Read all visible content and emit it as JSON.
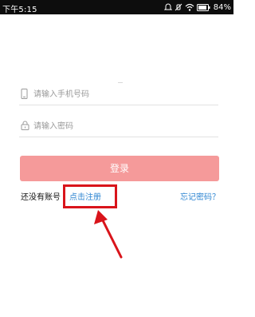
{
  "status_bar": {
    "time": "下午5:15",
    "battery": "84%",
    "icons": [
      "notification-icon",
      "mute-icon",
      "wifi-icon",
      "battery-icon"
    ]
  },
  "form": {
    "phone_placeholder": "请输入手机号码",
    "password_placeholder": "请输入密码",
    "phone_icon": "phone-icon",
    "password_icon": "lock-icon"
  },
  "login_button": {
    "label": "登录",
    "color": "#f59a9a"
  },
  "links": {
    "no_account": "还没有账号",
    "register": "点击注册",
    "forgot_password": "忘记密码？",
    "link_color": "#2f86d2"
  },
  "annotation": {
    "highlight_color": "#d9141b",
    "target": "register"
  }
}
